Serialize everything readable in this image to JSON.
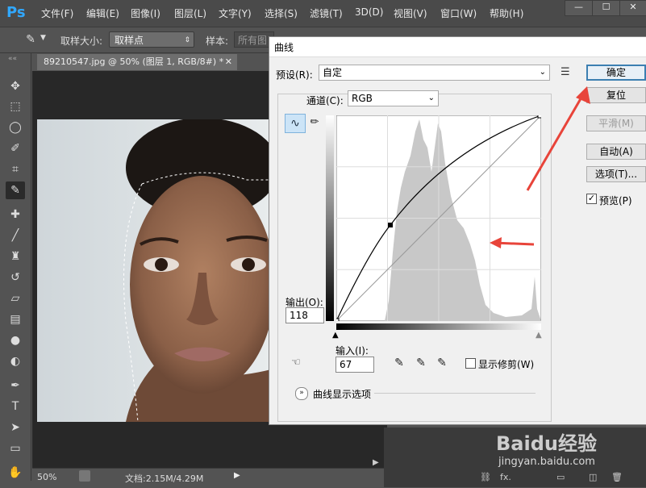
{
  "app": {
    "logo": "Ps",
    "menu": [
      "文件(F)",
      "编辑(E)",
      "图像(I)",
      "图层(L)",
      "文字(Y)",
      "选择(S)",
      "滤镜(T)",
      "3D(D)",
      "视图(V)",
      "窗口(W)",
      "帮助(H)"
    ],
    "window_controls": [
      "minimize-icon",
      "maximize-icon",
      "close-icon"
    ]
  },
  "options": {
    "sample_size_label": "取样大小:",
    "sample_size_value": "取样点",
    "sample_label": "样本:",
    "sample_value": "所有图"
  },
  "document": {
    "tab_title": "89210547.jpg @ 50% (图层 1, RGB/8#) *",
    "zoom": "50%",
    "doc_info": "文档:2.15M/4.29M"
  },
  "curves_dialog": {
    "title": "曲线",
    "preset_label": "预设(R):",
    "preset_value": "自定",
    "channel_label": "通道(C):",
    "channel_value": "RGB",
    "output_label": "输出(O):",
    "output_value": "118",
    "input_label": "输入(I):",
    "input_value": "67",
    "show_clipping_label": "显示修剪(W)",
    "show_clipping_checked": false,
    "curve_display_options_label": "曲线显示选项",
    "buttons": {
      "ok": "确定",
      "reset": "复位",
      "smooth": "平滑(M)",
      "auto": "自动(A)",
      "options": "选项(T)...",
      "preview": "预览(P)"
    },
    "preview_checked": true
  },
  "watermark": {
    "brand": "Baidu经验",
    "url": "jingyan.baidu.com"
  },
  "colors": {
    "ps_blue": "#31a8ff",
    "annotation_red": "#e8443a",
    "default_button_border": "#3c7fb1"
  }
}
